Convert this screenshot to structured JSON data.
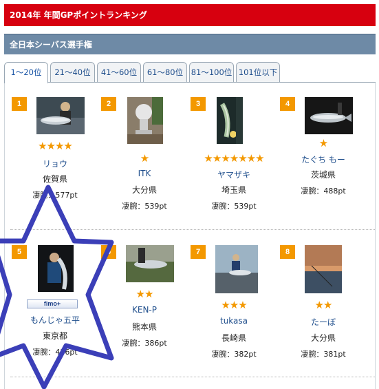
{
  "header": {
    "title": "2014年  年間GPポイントランキング"
  },
  "section": {
    "title": "全日本シーバス選手権"
  },
  "tabs": [
    {
      "label": "1〜20位",
      "active": true
    },
    {
      "label": "21〜40位"
    },
    {
      "label": "41〜60位"
    },
    {
      "label": "61〜80位"
    },
    {
      "label": "81〜100位"
    },
    {
      "label": "101位以下"
    }
  ],
  "rankings": [
    {
      "rank": "1",
      "stars": "★★★★",
      "name": "リョウ",
      "pref": "佐賀県",
      "points": "凄腕：577pt",
      "photo": "angler-with-fish"
    },
    {
      "rank": "2",
      "stars": "★",
      "name": "ITK",
      "pref": "大分県",
      "points": "凄腕：539pt",
      "photo": "stone-lantern"
    },
    {
      "rank": "3",
      "stars": "★★★★★★★",
      "name": "ヤマザキ",
      "pref": "埼玉県",
      "points": "凄腕：539pt",
      "photo": "fish-held-night"
    },
    {
      "rank": "4",
      "stars": "★",
      "name": "たぐち  もー",
      "pref": "茨城県",
      "points": "凄腕：488pt",
      "photo": "fish-on-ground"
    },
    {
      "rank": "5",
      "stars": "",
      "badge": "fimo+",
      "name": "もんじゃ五平",
      "pref": "東京都",
      "points": "凄腕：436pt",
      "photo": "angler-night-tall"
    },
    {
      "rank": "6",
      "stars": "★★",
      "name": "KEN-P",
      "pref": "熊本県",
      "points": "凄腕：386pt",
      "photo": "fish-on-grass"
    },
    {
      "rank": "7",
      "stars": "★★★",
      "name": "tukasa",
      "pref": "長崎県",
      "points": "凄腕：382pt",
      "photo": "angler-rocks"
    },
    {
      "rank": "8",
      "stars": "★★",
      "name": "たーぼ",
      "pref": "大分県",
      "points": "凄腕：381pt",
      "photo": "sunset-water"
    }
  ],
  "colors": {
    "title_red": "#d7000f",
    "section_blue": "#6e8aa6",
    "rank_orange": "#f39800",
    "link_blue": "#1f4e8c",
    "overlay_star": "#3b3fb8"
  }
}
